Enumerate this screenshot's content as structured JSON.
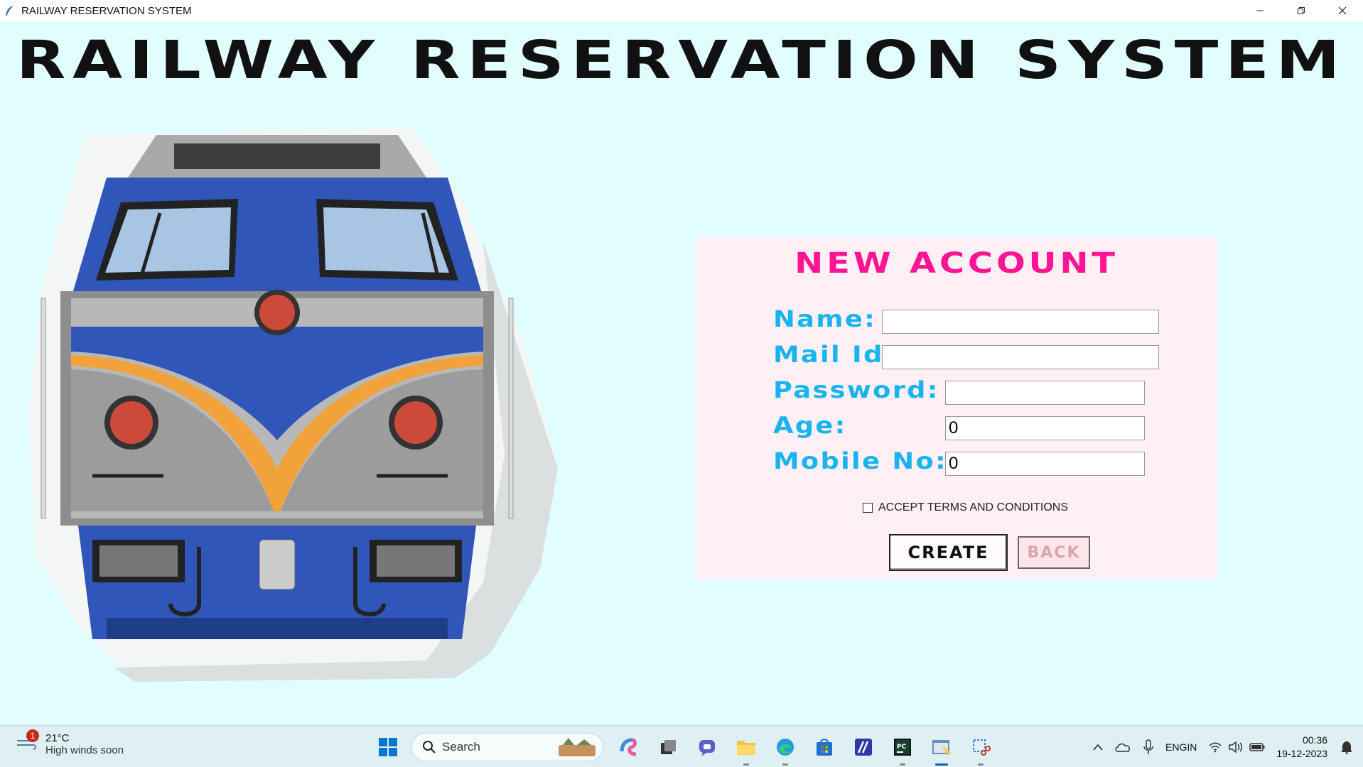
{
  "window": {
    "title": "RAILWAY RESERVATION SYSTEM"
  },
  "main": {
    "title": "RAILWAY RESERVATION SYSTEM"
  },
  "form": {
    "heading": "NEW ACCOUNT",
    "name_label": "Name:",
    "name_value": "",
    "mail_label": "Mail Id:",
    "mail_value": "",
    "password_label": "Password:",
    "password_value": "",
    "age_label": "Age:",
    "age_value": "0",
    "mobile_label": "Mobile No:",
    "mobile_value": "0",
    "terms_label": "ACCEPT TERMS AND CONDITIONS",
    "terms_checked": false,
    "create_label": "CREATE",
    "back_label": "BACK"
  },
  "colors": {
    "background": "#e1fdfd",
    "panel": "#fff0f5",
    "heading": "#ff1493",
    "label": "#18b4f0"
  },
  "taskbar": {
    "weather_temp": "21°C",
    "weather_condition": "High winds soon",
    "weather_badge": "1",
    "search_placeholder": "Search",
    "lang_top": "ENG",
    "lang_bottom": "IN",
    "time": "00:36",
    "date": "19-12-2023"
  }
}
